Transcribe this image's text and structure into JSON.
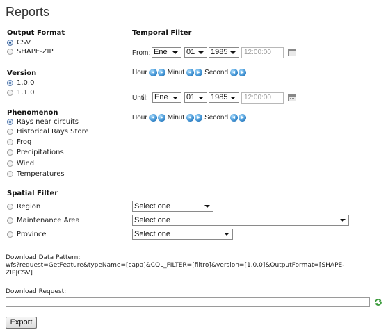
{
  "title": "Reports",
  "output_format": {
    "heading": "Output Format",
    "options": [
      {
        "label": "CSV",
        "checked": true
      },
      {
        "label": "SHAPE-ZIP",
        "checked": false
      }
    ]
  },
  "version": {
    "heading": "Version",
    "options": [
      {
        "label": "1.0.0",
        "checked": true
      },
      {
        "label": "1.1.0",
        "checked": false
      }
    ]
  },
  "phenomenon": {
    "heading": "Phenomenon",
    "options": [
      {
        "label": "Rays near circuits",
        "checked": true
      },
      {
        "label": "Historical Rays Store",
        "checked": false
      },
      {
        "label": "Frog",
        "checked": false
      },
      {
        "label": "Precipitations",
        "checked": false
      },
      {
        "label": "Wind",
        "checked": false
      },
      {
        "label": "Temperatures",
        "checked": false
      }
    ]
  },
  "temporal_filter": {
    "heading": "Temporal Filter",
    "from": {
      "label": "From:",
      "month": "Ene",
      "day": "01",
      "year": "1985",
      "time_placeholder": "12:00:00"
    },
    "until": {
      "label": "Until:",
      "month": "Ene",
      "day": "01",
      "year": "1985",
      "time_placeholder": "12:00:00"
    },
    "hour_label": "Hour",
    "minute_label": "Minut",
    "second_label": "Second"
  },
  "spatial_filter": {
    "heading": "Spatial Filter",
    "rows": [
      {
        "label": "Region",
        "select": "Select one",
        "checked": false
      },
      {
        "label": "Maintenance Area",
        "select": "Select one",
        "checked": false
      },
      {
        "label": "Province",
        "select": "Select one",
        "checked": false
      }
    ]
  },
  "download_pattern": {
    "label": "Download Data Pattern:",
    "line1": "wfs?request=GetFeature&typeName=[capa]&CQL_FILTER=[filtro]&version=[1.0.0]&OutputFormat=[SHAPE-",
    "line2": "ZIP|CSV]"
  },
  "download_request": {
    "label": "Download Request:",
    "value": ""
  },
  "export_button": "Export",
  "icons": {
    "calendar": "calendar-icon",
    "spinner": "spinner-arrow-icon",
    "refresh": "refresh-icon"
  },
  "colors": {
    "spinner_blue": "#3d8fd1",
    "radio_checked": "#1b4f8a",
    "refresh_green": "#3a9a3a"
  }
}
